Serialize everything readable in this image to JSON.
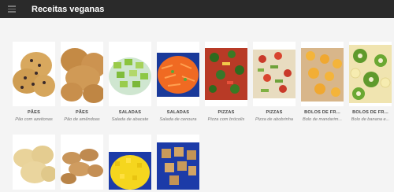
{
  "appbar": {
    "title": "Receitas veganas",
    "menu_icon": "hamburger-menu-icon"
  },
  "recipes": [
    {
      "category": "PÃES",
      "name": "Pão com azeitonas",
      "image": "olive-bread"
    },
    {
      "category": "PÃES",
      "name": "Pão de amêndoas",
      "image": "almond-bread"
    },
    {
      "category": "SALADAS",
      "name": "Salada de abacate",
      "image": "avocado-salad"
    },
    {
      "category": "SALADAS",
      "name": "Salada de cenoura",
      "image": "carrot-salad"
    },
    {
      "category": "PIZZAS",
      "name": "Pizza com brócolis",
      "image": "broccoli-pizza"
    },
    {
      "category": "PIZZAS",
      "name": "Pizza de abobrinha",
      "image": "zucchini-pizza"
    },
    {
      "category": "BOLOS DE FR...",
      "name": "Bolo de mandarim...",
      "image": "mandarin-cake"
    },
    {
      "category": "BOLOS DE FR...",
      "name": "Bolo de banana e...",
      "image": "banana-kiwi-cake"
    }
  ],
  "recipes_row2": [
    {
      "image": "buns"
    },
    {
      "image": "cookies"
    },
    {
      "image": "corn-bowl"
    },
    {
      "image": "tofu-bowl"
    }
  ]
}
